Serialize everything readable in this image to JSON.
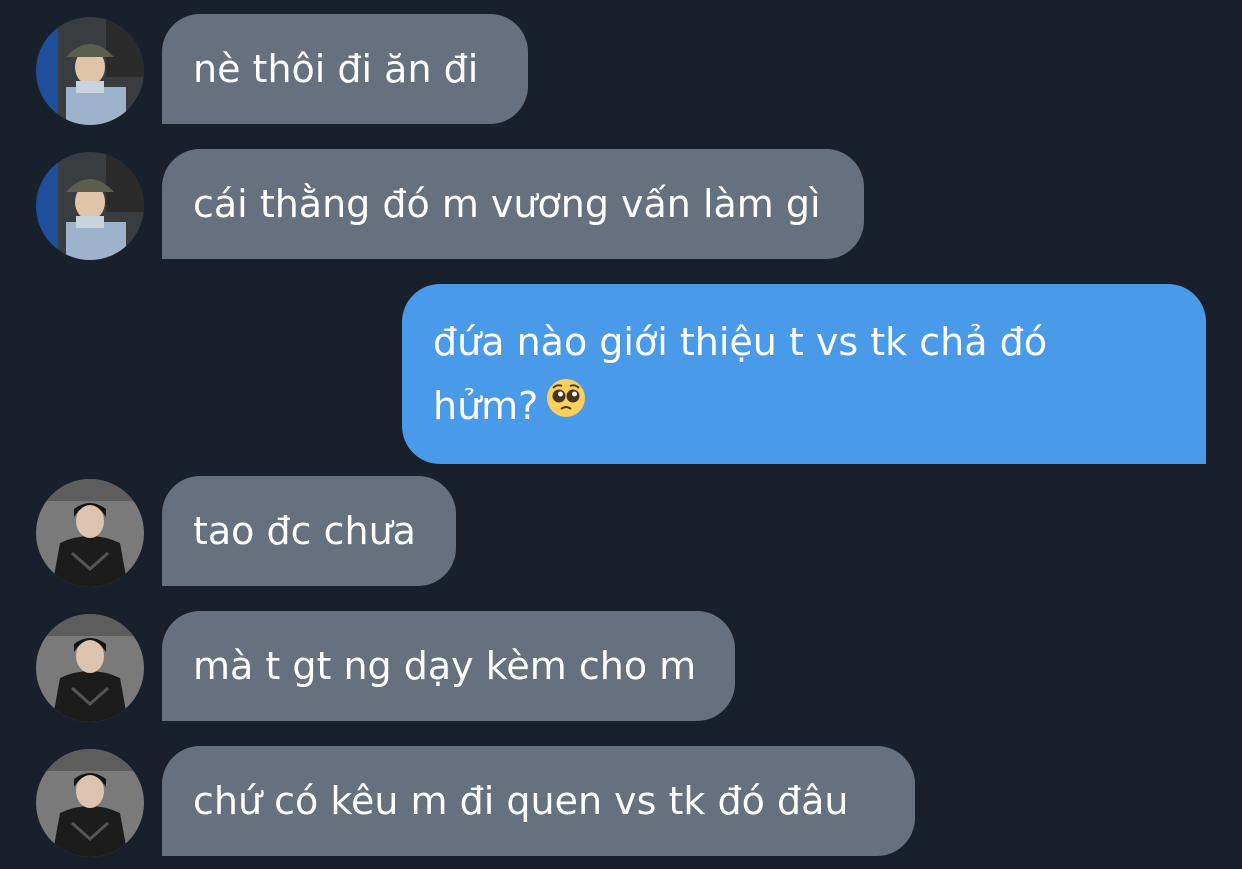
{
  "messages": [
    {
      "sender": "other",
      "avatar": "bucket-hat-avatar",
      "text": "nè thôi đi ăn đi"
    },
    {
      "sender": "other",
      "avatar": "bucket-hat-avatar",
      "text": "cái thằng đó m vương vấn làm gì"
    },
    {
      "sender": "me",
      "text_line1": "đứa nào giới thiệu t vs tk chả đó",
      "text_line2": "hửm?",
      "emoji": "pleading-face-emoji"
    },
    {
      "sender": "other",
      "avatar": "leather-jacket-avatar",
      "text": "tao đc chưa"
    },
    {
      "sender": "other",
      "avatar": "leather-jacket-avatar",
      "text": "mà t gt ng dạy kèm cho m"
    },
    {
      "sender": "other",
      "avatar": "leather-jacket-avatar",
      "text": "chứ có kêu m đi quen vs tk đó đâu"
    }
  ],
  "colors": {
    "background": "#18202b",
    "received_bubble": "#66717f",
    "sent_bubble": "#4a9aea",
    "text": "#ffffff"
  }
}
